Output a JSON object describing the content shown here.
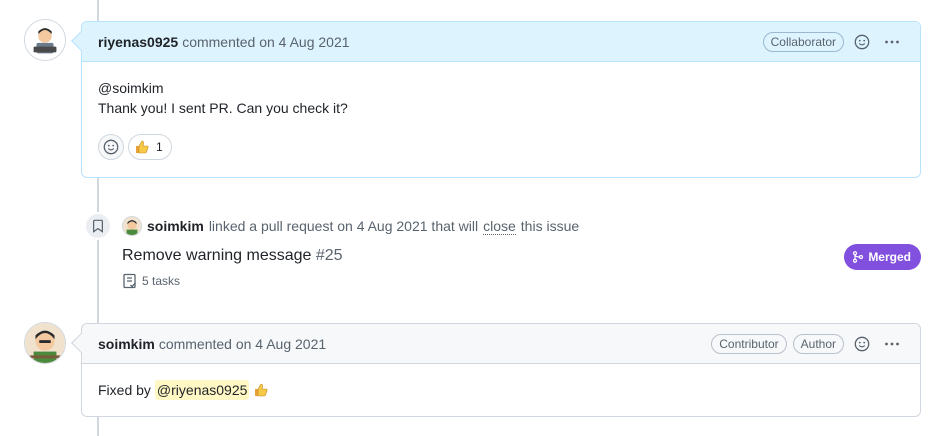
{
  "comment1": {
    "author": "riyenas0925",
    "meta": "commented on 4 Aug 2021",
    "badge": "Collaborator",
    "line1": "@soimkim",
    "line2": "Thank you! I sent PR. Can you check it?",
    "reaction_count": "1"
  },
  "event": {
    "actor": "soimkim",
    "text_before": "linked a pull request on 4 Aug 2021 that will",
    "close_word": "close",
    "text_after": "this issue",
    "pr_title": "Remove warning message",
    "pr_number": "#25",
    "tasks": "5 tasks",
    "status": "Merged"
  },
  "comment2": {
    "author": "soimkim",
    "meta": "commented on 4 Aug 2021",
    "badge1": "Contributor",
    "badge2": "Author",
    "body_prefix": "Fixed by",
    "mention": "@riyenas0925"
  },
  "colors": {
    "merged": "#8250df",
    "header_blue": "#ddf4ff",
    "mention_bg": "#fff8c5"
  },
  "icons": [
    "smiley-icon",
    "kebab-icon",
    "thumbsup-icon",
    "bookmark-icon",
    "merge-icon",
    "tasklist-icon"
  ]
}
